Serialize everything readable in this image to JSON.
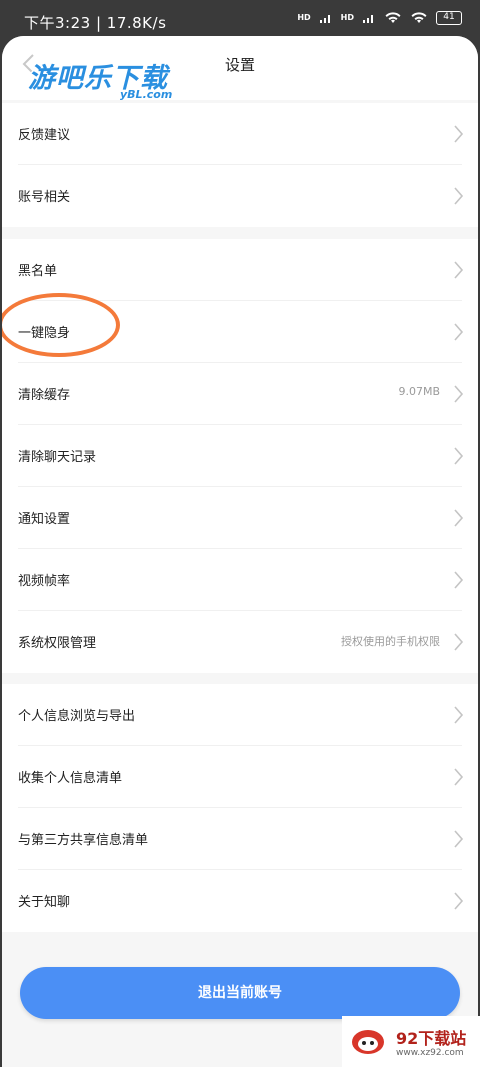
{
  "status_bar": {
    "time": "下午3:23 | 17.8K/s",
    "hd1": "HD",
    "hd2": "HD",
    "battery": "41"
  },
  "watermark_top": {
    "main": "游吧乐下载",
    "sub": "yBL.com"
  },
  "nav": {
    "title": "设置"
  },
  "groups": [
    {
      "items": [
        {
          "label": "反馈建议"
        },
        {
          "label": "账号相关"
        }
      ]
    },
    {
      "items": [
        {
          "label": "黑名单"
        },
        {
          "label": "一键隐身"
        },
        {
          "label": "清除缓存",
          "value": "9.07MB"
        },
        {
          "label": "清除聊天记录"
        },
        {
          "label": "通知设置"
        },
        {
          "label": "视频帧率"
        },
        {
          "label": "系统权限管理",
          "value": "授权使用的手机权限"
        }
      ]
    },
    {
      "items": [
        {
          "label": "个人信息浏览与导出"
        },
        {
          "label": "收集个人信息清单"
        },
        {
          "label": "与第三方共享信息清单"
        },
        {
          "label": "关于知聊"
        }
      ]
    }
  ],
  "logout_label": "退出当前账号",
  "watermark_br": {
    "main": "92下载站",
    "sub": "www.xz92.com"
  },
  "colors": {
    "accent": "#4b8ff5",
    "highlight_ring": "#f47a3a"
  },
  "icons": {
    "back": "chevron-left-icon",
    "row_arrow": "chevron-right-icon"
  }
}
